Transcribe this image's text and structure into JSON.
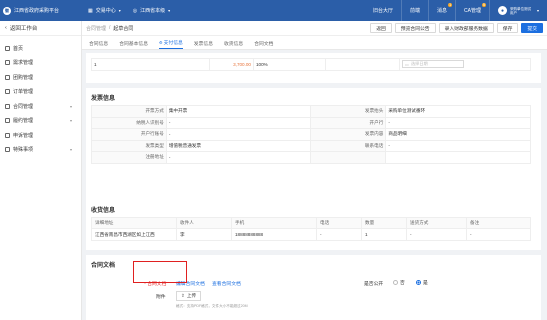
{
  "topbar": {
    "app_title": "江西省政府采购平台",
    "nav_trading_center": "交易中心",
    "nav_region": "江西省本级",
    "links": [
      "旧台大厅",
      "前端",
      "消息",
      "CA管理"
    ],
    "notice_badge": "1",
    "message_badge": "5",
    "user_name": "采购单位测试用户"
  },
  "sidebar": {
    "back_label": "返回工作台",
    "items": [
      {
        "label": "首页",
        "has_arrow": false
      },
      {
        "label": "需求管理",
        "has_arrow": false
      },
      {
        "label": "团购管理",
        "has_arrow": false
      },
      {
        "label": "订单管理",
        "has_arrow": false
      },
      {
        "label": "合同管理",
        "has_arrow": true
      },
      {
        "label": "履约管理",
        "has_arrow": true
      },
      {
        "label": "申诉管理",
        "has_arrow": false
      },
      {
        "label": "特殊事项",
        "has_arrow": true
      }
    ]
  },
  "breadcrumb": {
    "parent": "合同管理",
    "separator": "/",
    "current": "起草合同"
  },
  "actions": {
    "back": "返回",
    "preview": "预览合同公告",
    "import": "录入财政部服务数据",
    "save": "保存",
    "submit": "提交"
  },
  "tabs": [
    "合同信息",
    "合同基本信息",
    "支付信息",
    "发票信息",
    "收货信息",
    "合同文档"
  ],
  "active_tab": 2,
  "payment_row": {
    "index": "1",
    "amount": "3,700.00",
    "percent": "100%",
    "date_placeholder": "选择日期"
  },
  "invoice": {
    "title": "发票信息",
    "rows": [
      [
        "开票方式",
        "集中开票",
        "发票抬头",
        "采购单位测试番环"
      ],
      [
        "纳税人识别号",
        "-",
        "开户行",
        "-"
      ],
      [
        "开户行账号",
        "-",
        "发票内容",
        "商品明细"
      ],
      [
        "发票类型",
        "增值税普通发票",
        "联系电话",
        "-"
      ],
      [
        "注册地址",
        "-",
        "",
        ""
      ]
    ]
  },
  "receiving": {
    "title": "收货信息",
    "headers": [
      "详细地址",
      "收件人",
      "手机",
      "电话",
      "数量",
      "送货方式",
      "备注"
    ],
    "rows": [
      [
        "江西省南昌市西湖区如上江西",
        "李",
        "18888888888",
        "-",
        "1",
        "-",
        "-"
      ]
    ]
  },
  "doc": {
    "title": "合同文档",
    "label": "* 合同文档",
    "edit_link": "编辑合同文档",
    "view_link": "查看合同文档",
    "public_label": "是否公开",
    "no": "否",
    "yes": "是",
    "attachment_label": "附件",
    "upload": "上传",
    "hint": "格式：支持PDF格式，文件大小不能超过20M"
  }
}
